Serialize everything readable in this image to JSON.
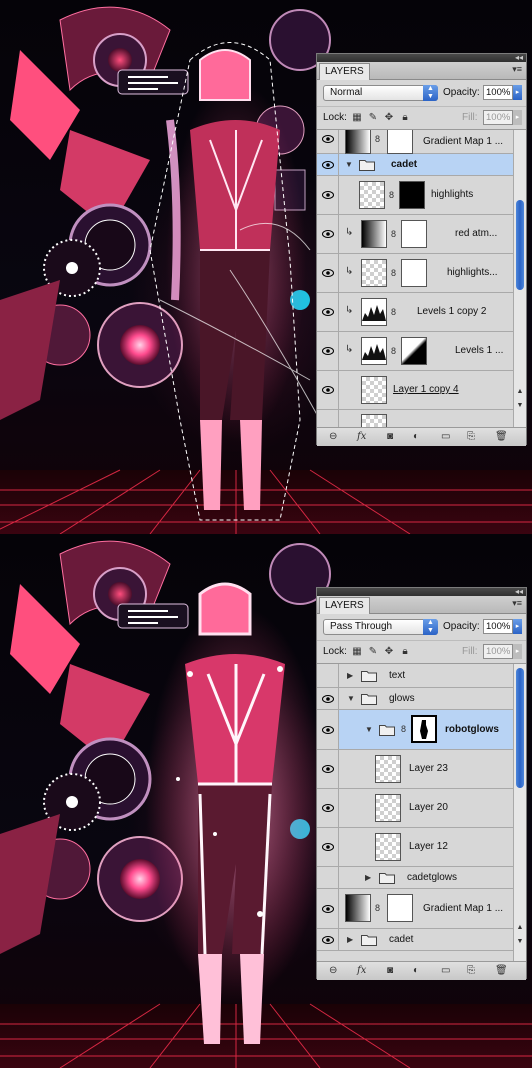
{
  "panels": [
    {
      "tab": "LAYERS",
      "blend_mode": "Normal",
      "opacity_label": "Opacity:",
      "opacity": "100%",
      "lock_label": "Lock:",
      "fill_label": "Fill:",
      "fill": "100%",
      "layers": [
        {
          "name": "Gradient Map 1 ..."
        },
        {
          "name": "cadet"
        },
        {
          "name": "highlights"
        },
        {
          "name": "red atm..."
        },
        {
          "name": "highlights..."
        },
        {
          "name": "Levels 1 copy 2"
        },
        {
          "name": "Levels 1 ..."
        },
        {
          "name": "Layer 1 copy 4"
        }
      ]
    },
    {
      "tab": "LAYERS",
      "blend_mode": "Pass Through",
      "opacity_label": "Opacity:",
      "opacity": "100%",
      "lock_label": "Lock:",
      "fill_label": "Fill:",
      "fill": "100%",
      "layers": [
        {
          "name": "text"
        },
        {
          "name": "glows"
        },
        {
          "name": "robotglows"
        },
        {
          "name": "Layer 23"
        },
        {
          "name": "Layer 20"
        },
        {
          "name": "Layer 12"
        },
        {
          "name": "cadetglows"
        },
        {
          "name": "Gradient Map 1 ..."
        },
        {
          "name": "cadet"
        }
      ]
    }
  ],
  "footer_icons": [
    "link-icon",
    "fx-icon",
    "mask-icon",
    "adjustment-icon",
    "group-icon",
    "new-layer-icon",
    "trash-icon"
  ],
  "colors": {
    "selection": "#b8d3f4",
    "accent_blue": "#2b63c6",
    "neon_pink": "#ff3d78"
  }
}
